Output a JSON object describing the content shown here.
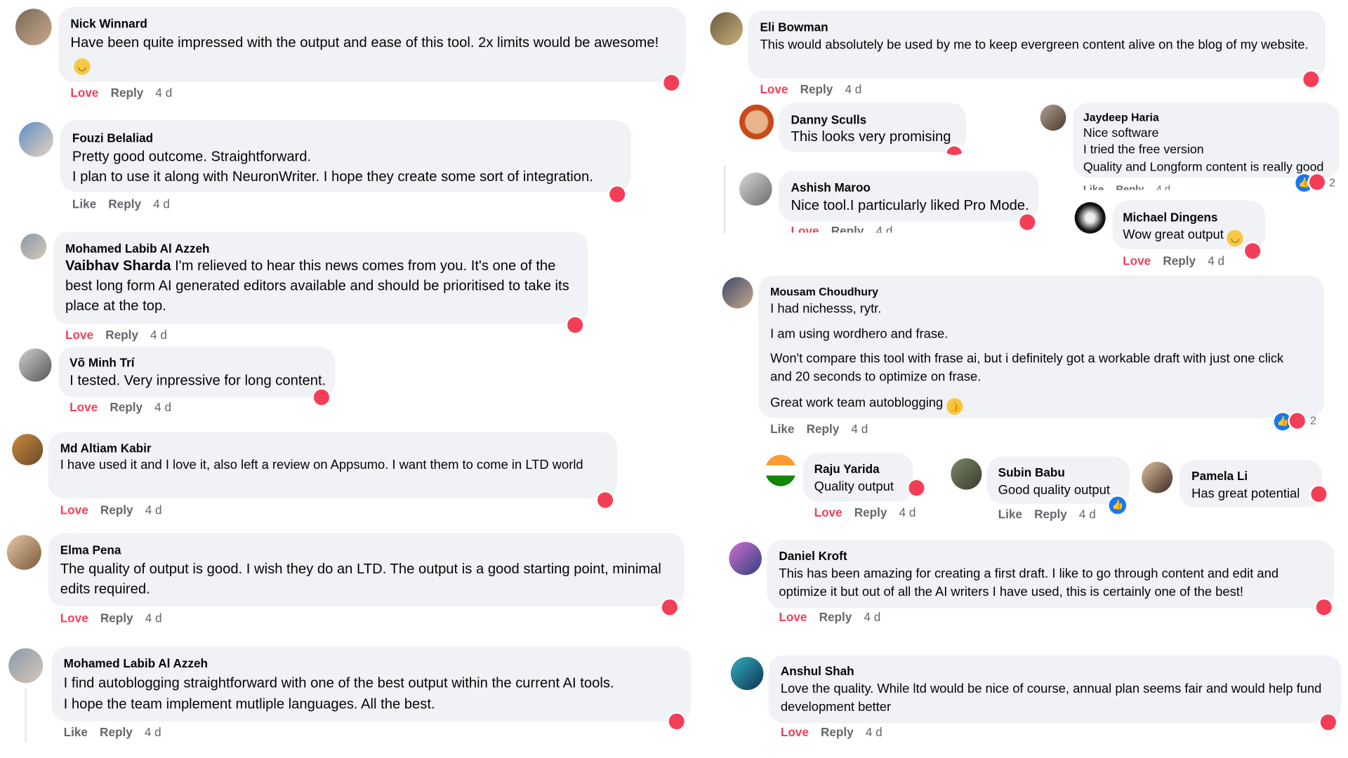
{
  "actions": {
    "love": "Love",
    "like": "Like",
    "reply": "Reply",
    "time": "4 d"
  },
  "comments": {
    "c1": {
      "name": "Nick Winnard",
      "text": "Have been quite impressed with the output and ease of this tool. 2x limits would be awesome!"
    },
    "c2": {
      "name": "Fouzi Belaliad",
      "line1": "Pretty good outcome. Straightforward.",
      "line2": "I plan to use it along with NeuronWriter. I hope they create some sort of integration."
    },
    "c3": {
      "name": "Mohamed Labib Al Azzeh",
      "mention": "Vaibhav Sharda",
      "text": " I'm relieved to hear this news comes from you. It's one of the best long form AI generated editors available and should be prioritised to take its place at the top."
    },
    "c4": {
      "name": "Võ Minh Trí",
      "text": "I tested. Very inpressive for long content."
    },
    "c5": {
      "name": "Md Altiam Kabir",
      "text": "I have used it and I love it, also left a review on Appsumo. I want them to come in LTD world"
    },
    "c6": {
      "name": "Elma Pena",
      "text": "The quality of output is good. I wish they do an LTD. The output is a good starting point, minimal edits required."
    },
    "c7": {
      "name": "Mohamed Labib Al Azzeh",
      "line1": "I find autoblogging straightforward with one of the best output within the current AI tools.",
      "line2": "I hope the team implement mutliple languages. All the best."
    },
    "c8": {
      "name": "Eli Bowman",
      "text": "This would absolutely be used by me to keep evergreen content alive on the blog of my website."
    },
    "c9": {
      "name": "Danny Sculls",
      "text": "This looks very promising"
    },
    "c10": {
      "name": "Ashish Maroo",
      "text": "Nice tool.I particularly liked Pro Mode."
    },
    "c11": {
      "name": "Jaydeep Haria",
      "line1": "Nice software",
      "line2": "I tried the free version",
      "line3": "Quality and Longform content is really good",
      "count": "2"
    },
    "c12": {
      "name": "Michael Dingens",
      "text": "Wow great output"
    },
    "c13": {
      "name": "Mousam Choudhury",
      "line1": "I had nichesss, rytr.",
      "line2": "I am using wordhero and frase.",
      "line3": "Won't compare this tool with frase ai, but i definitely got a workable draft with just one click and 20 seconds to optimize on frase.",
      "line4": "Great work team autoblogging",
      "count": "2"
    },
    "c14": {
      "name": "Raju Yarida",
      "text": "Quality output"
    },
    "c15": {
      "name": "Subin Babu",
      "text": "Good quality output"
    },
    "c16": {
      "name": "Pamela Li",
      "text": "Has great potential"
    },
    "c17": {
      "name": "Daniel Kroft",
      "text": "This has been amazing for creating a first draft. I like to go through content and edit and optimize it but out of all the AI writers I have used, this is certainly one of the best!"
    },
    "c18": {
      "name": "Anshul Shah",
      "text": "Love the quality. While ltd would be nice of course, annual plan seems fair and would help fund development better"
    }
  },
  "colors": {
    "bubble": "#f0f2f5",
    "love": "#f33e58",
    "like": "#1877f2",
    "meta": "#65676b"
  }
}
